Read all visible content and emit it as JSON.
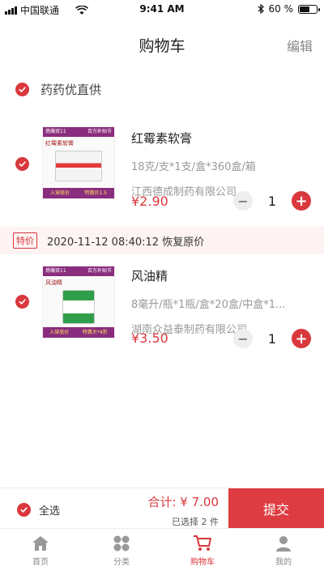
{
  "status_bar": {
    "carrier": "中国联通",
    "time": "9:41 AM",
    "battery": "60 %"
  },
  "header": {
    "title": "购物车",
    "edit_label": "编辑"
  },
  "store": {
    "name": "药药优直供"
  },
  "items": [
    {
      "title": "红霉素软膏",
      "spec": "18克/支*1支/盒*360盒/箱",
      "manufacturer": "江西德成制药有限公司",
      "price": "¥2.90",
      "quantity": "1",
      "thumb": {
        "banner_left": "燃爆双11",
        "banner_right": "百万补贴节",
        "name": "红霉素软膏",
        "foot_left": "入穿底价",
        "foot_right": "特惠价1.5"
      }
    },
    {
      "title": "风油精",
      "spec": "8毫升/瓶*1瓶/盒*20盒/中盒*1...",
      "manufacturer": "湖南众益泰制药有限公司",
      "price": "¥3.50",
      "quantity": "1",
      "thumb": {
        "banner_left": "燃爆双11",
        "banner_right": "百万补贴节",
        "name": "风油精",
        "foot_left": "入穿底价",
        "foot_right": "特惠大*4折"
      }
    }
  ],
  "promo": {
    "tag": "特价",
    "text": "2020-11-12  08:40:12 恢复原价"
  },
  "checkout": {
    "select_all": "全选",
    "total": "合计: ¥ 7.00",
    "selected_count": "已选择 2 件",
    "submit": "提交"
  },
  "tabs": [
    {
      "label": "首页",
      "icon": "home-icon"
    },
    {
      "label": "分类",
      "icon": "category-icon"
    },
    {
      "label": "购物车",
      "icon": "cart-icon",
      "active": true
    },
    {
      "label": "我的",
      "icon": "user-icon"
    }
  ],
  "colors": {
    "accent": "#d9383d",
    "muted": "#999999"
  }
}
